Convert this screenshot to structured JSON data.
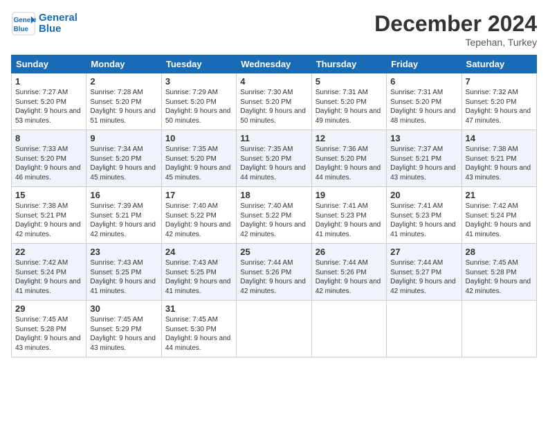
{
  "header": {
    "logo_line1": "General",
    "logo_line2": "Blue",
    "month_title": "December 2024",
    "subtitle": "Tepehan, Turkey"
  },
  "weekdays": [
    "Sunday",
    "Monday",
    "Tuesday",
    "Wednesday",
    "Thursday",
    "Friday",
    "Saturday"
  ],
  "weeks": [
    [
      {
        "day": "1",
        "sunrise": "7:27 AM",
        "sunset": "5:20 PM",
        "daylight": "9 hours and 53 minutes."
      },
      {
        "day": "2",
        "sunrise": "7:28 AM",
        "sunset": "5:20 PM",
        "daylight": "9 hours and 51 minutes."
      },
      {
        "day": "3",
        "sunrise": "7:29 AM",
        "sunset": "5:20 PM",
        "daylight": "9 hours and 50 minutes."
      },
      {
        "day": "4",
        "sunrise": "7:30 AM",
        "sunset": "5:20 PM",
        "daylight": "9 hours and 50 minutes."
      },
      {
        "day": "5",
        "sunrise": "7:31 AM",
        "sunset": "5:20 PM",
        "daylight": "9 hours and 49 minutes."
      },
      {
        "day": "6",
        "sunrise": "7:31 AM",
        "sunset": "5:20 PM",
        "daylight": "9 hours and 48 minutes."
      },
      {
        "day": "7",
        "sunrise": "7:32 AM",
        "sunset": "5:20 PM",
        "daylight": "9 hours and 47 minutes."
      }
    ],
    [
      {
        "day": "8",
        "sunrise": "7:33 AM",
        "sunset": "5:20 PM",
        "daylight": "9 hours and 46 minutes."
      },
      {
        "day": "9",
        "sunrise": "7:34 AM",
        "sunset": "5:20 PM",
        "daylight": "9 hours and 45 minutes."
      },
      {
        "day": "10",
        "sunrise": "7:35 AM",
        "sunset": "5:20 PM",
        "daylight": "9 hours and 45 minutes."
      },
      {
        "day": "11",
        "sunrise": "7:35 AM",
        "sunset": "5:20 PM",
        "daylight": "9 hours and 44 minutes."
      },
      {
        "day": "12",
        "sunrise": "7:36 AM",
        "sunset": "5:20 PM",
        "daylight": "9 hours and 44 minutes."
      },
      {
        "day": "13",
        "sunrise": "7:37 AM",
        "sunset": "5:21 PM",
        "daylight": "9 hours and 43 minutes."
      },
      {
        "day": "14",
        "sunrise": "7:38 AM",
        "sunset": "5:21 PM",
        "daylight": "9 hours and 43 minutes."
      }
    ],
    [
      {
        "day": "15",
        "sunrise": "7:38 AM",
        "sunset": "5:21 PM",
        "daylight": "9 hours and 42 minutes."
      },
      {
        "day": "16",
        "sunrise": "7:39 AM",
        "sunset": "5:21 PM",
        "daylight": "9 hours and 42 minutes."
      },
      {
        "day": "17",
        "sunrise": "7:40 AM",
        "sunset": "5:22 PM",
        "daylight": "9 hours and 42 minutes."
      },
      {
        "day": "18",
        "sunrise": "7:40 AM",
        "sunset": "5:22 PM",
        "daylight": "9 hours and 42 minutes."
      },
      {
        "day": "19",
        "sunrise": "7:41 AM",
        "sunset": "5:23 PM",
        "daylight": "9 hours and 41 minutes."
      },
      {
        "day": "20",
        "sunrise": "7:41 AM",
        "sunset": "5:23 PM",
        "daylight": "9 hours and 41 minutes."
      },
      {
        "day": "21",
        "sunrise": "7:42 AM",
        "sunset": "5:24 PM",
        "daylight": "9 hours and 41 minutes."
      }
    ],
    [
      {
        "day": "22",
        "sunrise": "7:42 AM",
        "sunset": "5:24 PM",
        "daylight": "9 hours and 41 minutes."
      },
      {
        "day": "23",
        "sunrise": "7:43 AM",
        "sunset": "5:25 PM",
        "daylight": "9 hours and 41 minutes."
      },
      {
        "day": "24",
        "sunrise": "7:43 AM",
        "sunset": "5:25 PM",
        "daylight": "9 hours and 41 minutes."
      },
      {
        "day": "25",
        "sunrise": "7:44 AM",
        "sunset": "5:26 PM",
        "daylight": "9 hours and 42 minutes."
      },
      {
        "day": "26",
        "sunrise": "7:44 AM",
        "sunset": "5:26 PM",
        "daylight": "9 hours and 42 minutes."
      },
      {
        "day": "27",
        "sunrise": "7:44 AM",
        "sunset": "5:27 PM",
        "daylight": "9 hours and 42 minutes."
      },
      {
        "day": "28",
        "sunrise": "7:45 AM",
        "sunset": "5:28 PM",
        "daylight": "9 hours and 42 minutes."
      }
    ],
    [
      {
        "day": "29",
        "sunrise": "7:45 AM",
        "sunset": "5:28 PM",
        "daylight": "9 hours and 43 minutes."
      },
      {
        "day": "30",
        "sunrise": "7:45 AM",
        "sunset": "5:29 PM",
        "daylight": "9 hours and 43 minutes."
      },
      {
        "day": "31",
        "sunrise": "7:45 AM",
        "sunset": "5:30 PM",
        "daylight": "9 hours and 44 minutes."
      },
      null,
      null,
      null,
      null
    ]
  ]
}
